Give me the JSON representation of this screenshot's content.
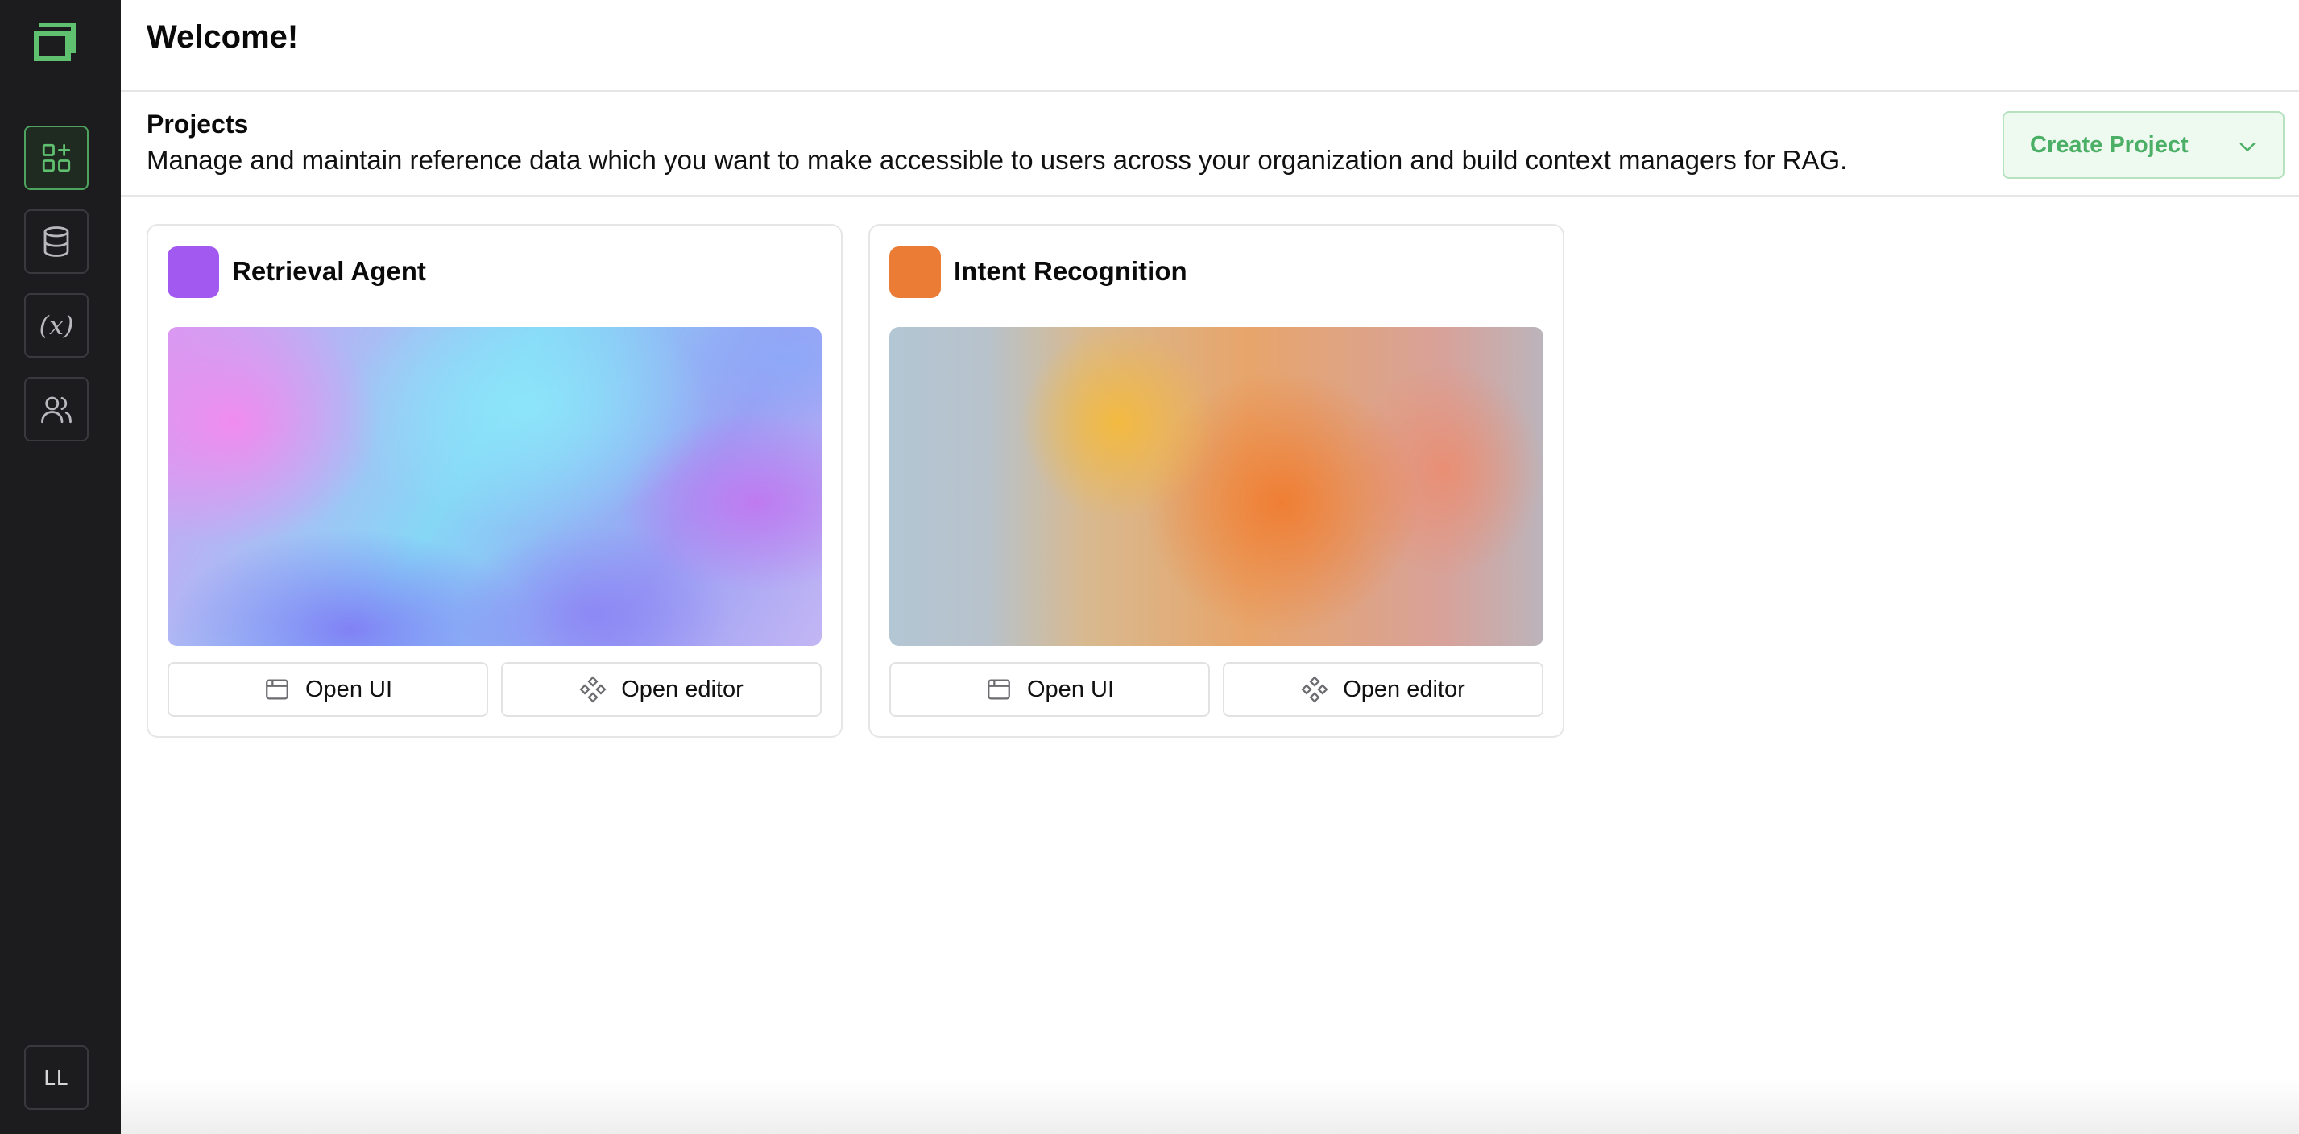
{
  "header": {
    "title": "Welcome!"
  },
  "sidebar": {
    "items": [
      {
        "name": "projects",
        "icon": "grid-plus-icon",
        "active": true
      },
      {
        "name": "database",
        "icon": "database-icon",
        "active": false
      },
      {
        "name": "variables",
        "icon": "function-icon",
        "label": "(x)",
        "active": false
      },
      {
        "name": "users",
        "icon": "users-icon",
        "active": false
      }
    ],
    "avatar_initials": "LL"
  },
  "section": {
    "title": "Projects",
    "description": "Manage and maintain reference data which you want to make accessible to users across your organization and build context managers for RAG.",
    "create_label": "Create Project"
  },
  "projects": [
    {
      "title": "Retrieval Agent",
      "color": "#a259f0",
      "open_ui_label": "Open UI",
      "open_editor_label": "Open editor"
    },
    {
      "title": "Intent Recognition",
      "color": "#ea7c35",
      "open_ui_label": "Open UI",
      "open_editor_label": "Open editor"
    }
  ],
  "colors": {
    "accent": "#4caf66",
    "sidebar_bg": "#1c1c1e"
  }
}
